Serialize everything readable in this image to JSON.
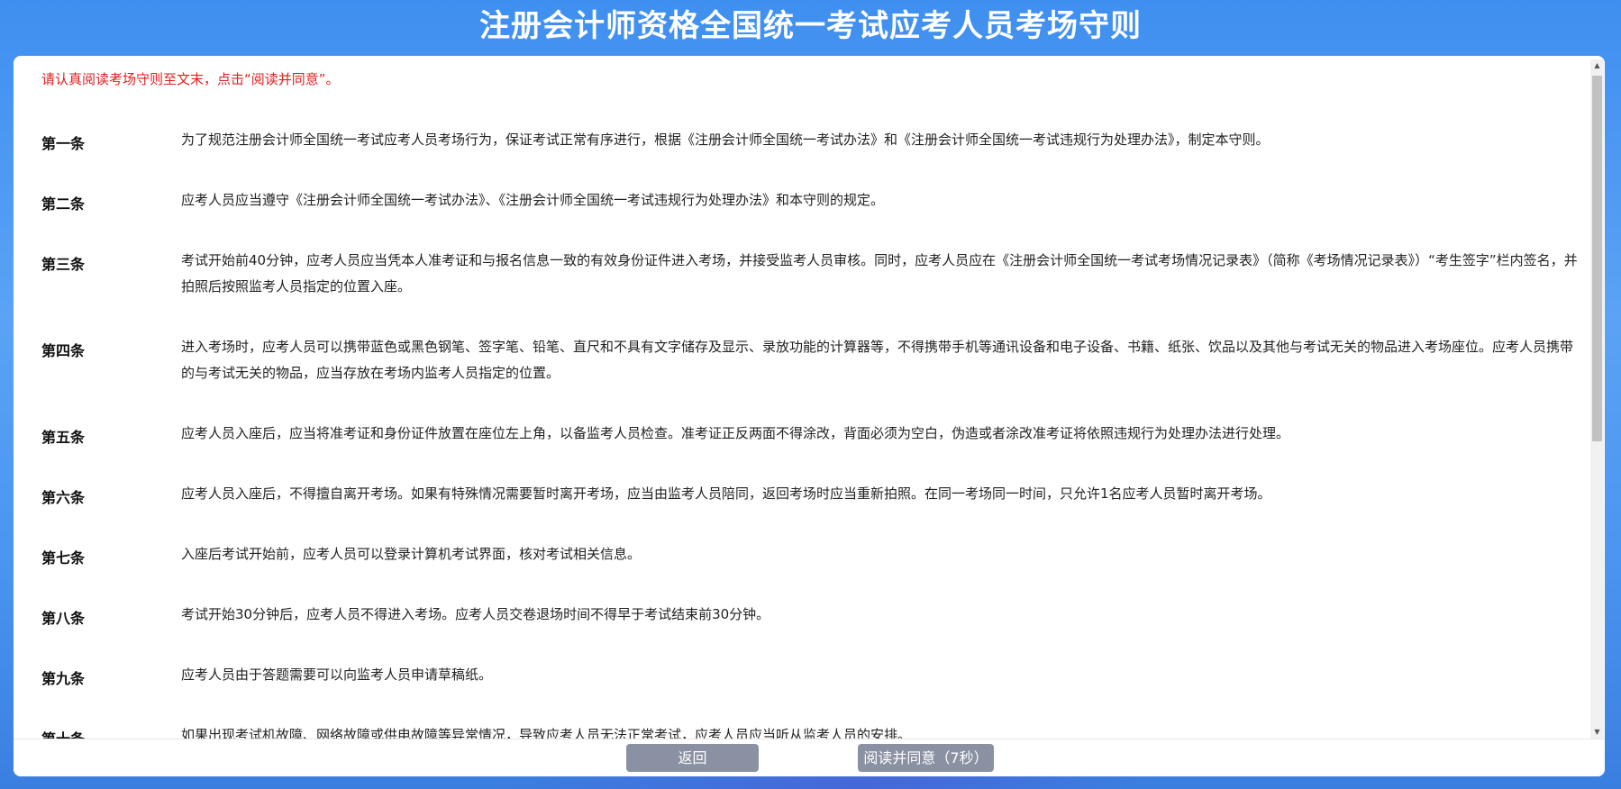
{
  "page": {
    "title": "注册会计师资格全国统一考试应考人员考场守则"
  },
  "notice": "请认真阅读考场守则至文末，点击“阅读并同意”。",
  "rules": [
    {
      "no": "第一条",
      "text": "为了规范注册会计师全国统一考试应考人员考场行为，保证考试正常有序进行，根据《注册会计师全国统一考试办法》和《注册会计师全国统一考试违规行为处理办法》，制定本守则。"
    },
    {
      "no": "第二条",
      "text": "应考人员应当遵守《注册会计师全国统一考试办法》、《注册会计师全国统一考试违规行为处理办法》和本守则的规定。"
    },
    {
      "no": "第三条",
      "text": "考试开始前40分钟，应考人员应当凭本人准考证和与报名信息一致的有效身份证件进入考场，并接受监考人员审核。同时，应考人员应在《注册会计师全国统一考试考场情况记录表》（简称《考场情况记录表》）“考生签字”栏内签名，并拍照后按照监考人员指定的位置入座。"
    },
    {
      "no": "第四条",
      "text": "进入考场时，应考人员可以携带蓝色或黑色钢笔、签字笔、铅笔、直尺和不具有文字储存及显示、录放功能的计算器等，不得携带手机等通讯设备和电子设备、书籍、纸张、饮品以及其他与考试无关的物品进入考场座位。应考人员携带的与考试无关的物品，应当存放在考场内监考人员指定的位置。"
    },
    {
      "no": "第五条",
      "text": "应考人员入座后，应当将准考证和身份证件放置在座位左上角，以备监考人员检查。准考证正反两面不得涂改，背面必须为空白，伪造或者涂改准考证将依照违规行为处理办法进行处理。"
    },
    {
      "no": "第六条",
      "text": "应考人员入座后，不得擅自离开考场。如果有特殊情况需要暂时离开考场，应当由监考人员陪同，返回考场时应当重新拍照。在同一考场同一时间，只允许1名应考人员暂时离开考场。"
    },
    {
      "no": "第七条",
      "text": "入座后考试开始前，应考人员可以登录计算机考试界面，核对考试相关信息。"
    },
    {
      "no": "第八条",
      "text": "考试开始30分钟后，应考人员不得进入考场。应考人员交卷退场时间不得早于考试结束前30分钟。"
    },
    {
      "no": "第九条",
      "text": "应考人员由于答题需要可以向监考人员申请草稿纸。"
    },
    {
      "no": "第十条",
      "text": "如果出现考试机故障、网络故障或供电故障等异常情况，导致应考人员无法正常考试，应考人员应当听从监考人员的安排。"
    }
  ],
  "buttons": {
    "back": "返回",
    "agree": "阅读并同意（7秒）"
  },
  "scrollbar": {
    "up_icon": "▲",
    "down_icon": "▼"
  },
  "colors": {
    "notice": "#e02020",
    "button": "#8a91a3",
    "background": "#4a96f0"
  }
}
